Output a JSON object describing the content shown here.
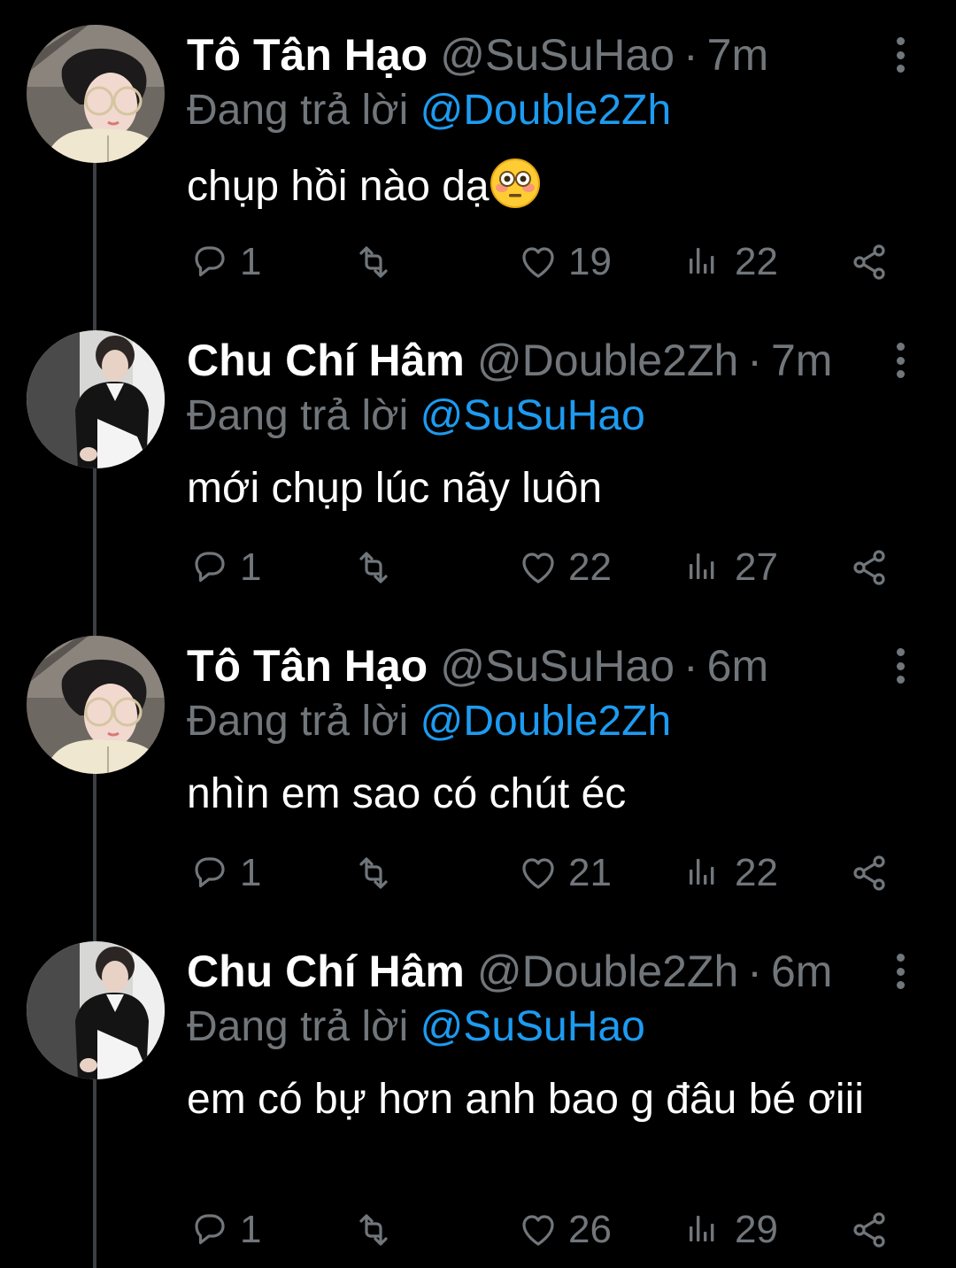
{
  "colors": {
    "background": "#000000",
    "text": "#ffffff",
    "muted": "#71767b",
    "link": "#1d9bf0",
    "thread_line": "#3b3f44"
  },
  "icons": {
    "reply": "reply-icon",
    "retweet": "retweet-icon",
    "like": "heart-icon",
    "views": "views-icon",
    "share": "share-icon",
    "more": "more-vertical-icon"
  },
  "tweets": [
    {
      "name": "Tô Tân Hạo",
      "handle": "@SuSuHao",
      "separator": "·",
      "time": "7m",
      "reply_prefix": "Đang trả lời",
      "reply_to": "@Double2Zh",
      "text": "chụp hồi nào dạ",
      "emoji": "flushed-face",
      "replies": "1",
      "retweets": "",
      "likes": "19",
      "views": "22"
    },
    {
      "name": "Chu Chí Hâm",
      "handle": "@Double2Zh",
      "separator": "·",
      "time": "7m",
      "reply_prefix": "Đang trả lời",
      "reply_to": "@SuSuHao",
      "text": "mới chụp lúc nãy luôn",
      "replies": "1",
      "retweets": "",
      "likes": "22",
      "views": "27"
    },
    {
      "name": "Tô Tân Hạo",
      "handle": "@SuSuHao",
      "separator": "·",
      "time": "6m",
      "reply_prefix": "Đang trả lời",
      "reply_to": "@Double2Zh",
      "text": "nhìn em sao có chút éc",
      "replies": "1",
      "retweets": "",
      "likes": "21",
      "views": "22"
    },
    {
      "name": "Chu Chí Hâm",
      "handle": "@Double2Zh",
      "separator": "·",
      "time": "6m",
      "reply_prefix": "Đang trả lời",
      "reply_to": "@SuSuHao",
      "text": "em có bự hơn anh bao g đâu bé ơiii",
      "replies": "1",
      "retweets": "",
      "likes": "26",
      "views": "29"
    }
  ]
}
